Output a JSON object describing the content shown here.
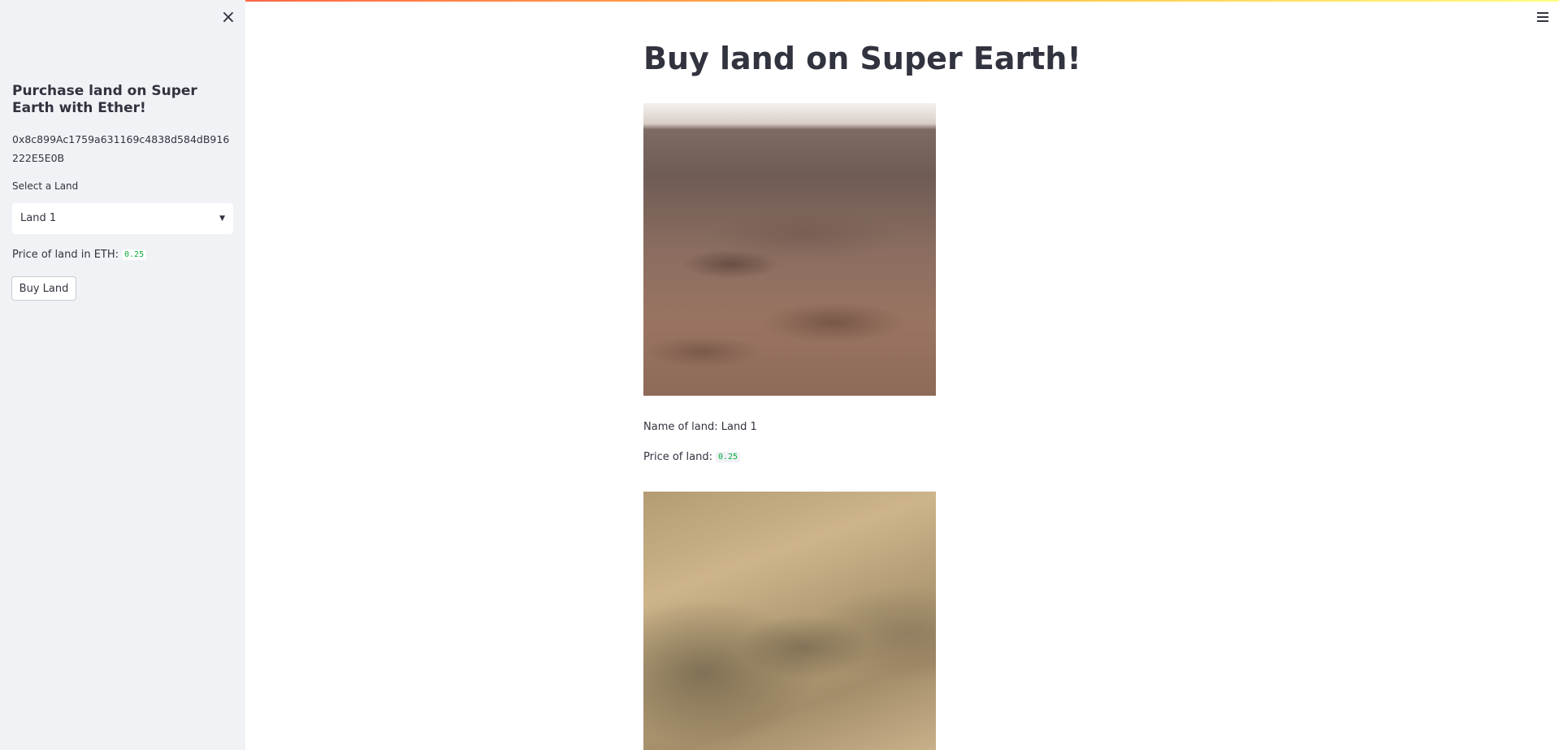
{
  "sidebar": {
    "close_label": "×",
    "title": "Purchase land on Super Earth with Ether!",
    "address": "0x8c899Ac1759a631169c4838d584dB916222E5E0B",
    "select_label": "Select a Land",
    "select_value": "Land 1",
    "price_label": "Price of land in ETH:",
    "price_value": "0.25",
    "buy_button_label": "Buy Land"
  },
  "main": {
    "title": "Buy land on Super Earth!",
    "land": {
      "name_label": "Name of land: Land 1",
      "price_label": "Price of land:",
      "price_value": "0.25"
    }
  },
  "colors": {
    "sidebar_bg": "#f0f2f6",
    "code_green": "#09ab3b",
    "text": "#31333f"
  },
  "icons": {
    "close": "close-icon",
    "menu": "hamburger-menu-icon",
    "select": "chevron-down-icon"
  }
}
